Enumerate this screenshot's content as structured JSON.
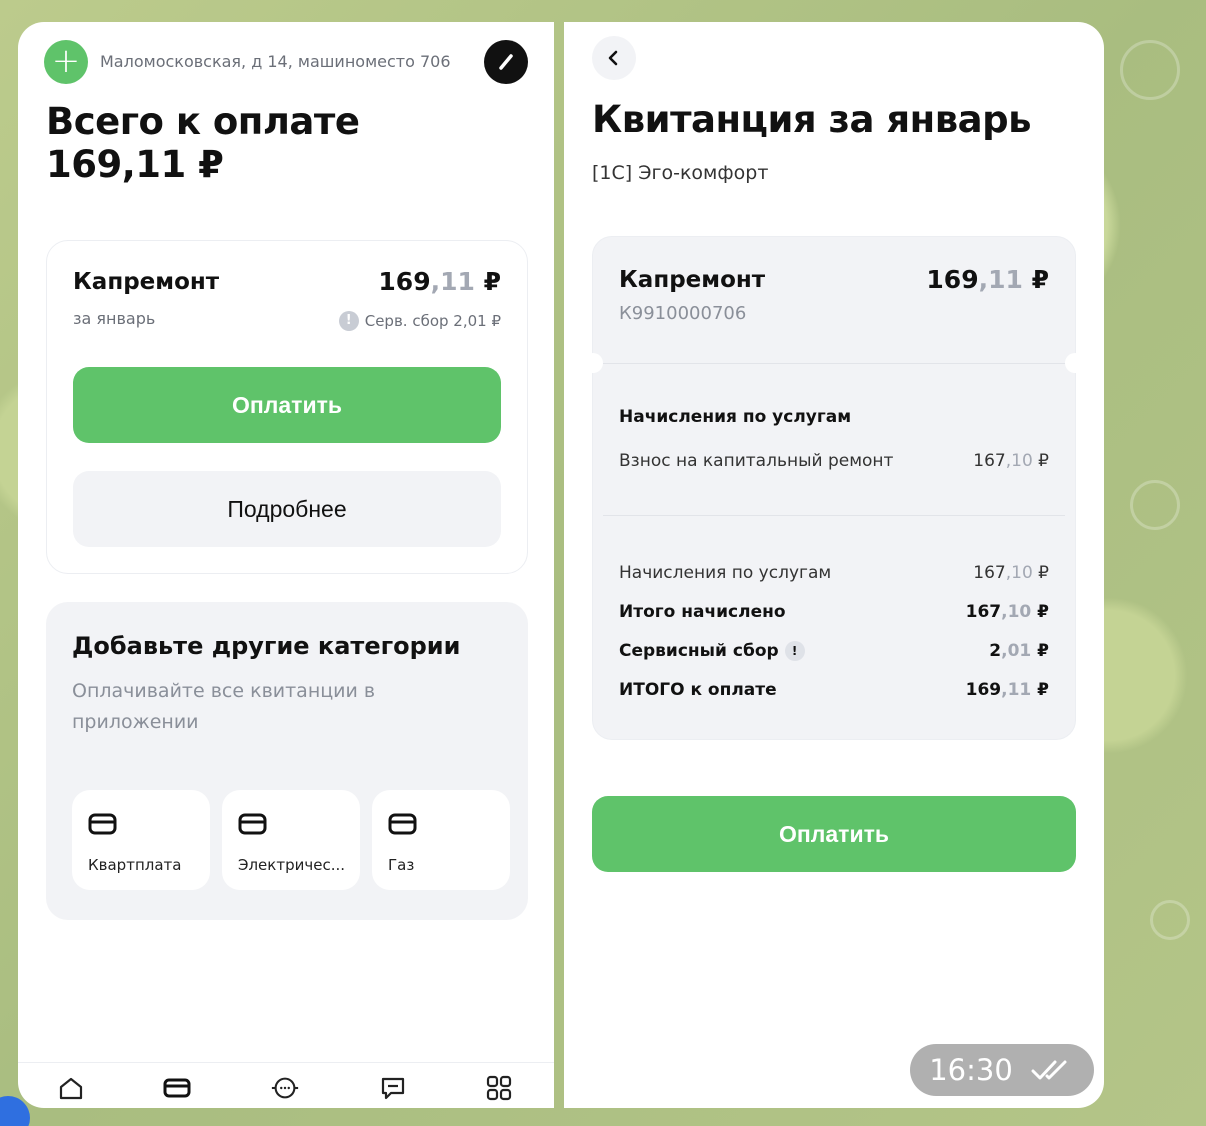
{
  "left": {
    "address": "Маломосковская, д 14, машиноместо 706",
    "total_title": "Всего к оплате",
    "total_amount": "169,11 ₽",
    "bill": {
      "title": "Капремонт",
      "period": "за январь",
      "amount_main": "169",
      "amount_kop": ",11",
      "currency": " ₽",
      "fee_text": "Серв. сбор 2,01 ₽",
      "pay_label": "Оплатить",
      "more_label": "Подробнее"
    },
    "categories": {
      "title": "Добавьте другие категории",
      "subtitle": "Оплачивайте все квитанции в приложении",
      "items": [
        {
          "label": "Квартплата",
          "icon": "wallet-icon"
        },
        {
          "label": "Электричес...",
          "icon": "wallet-icon"
        },
        {
          "label": "Газ",
          "icon": "wallet-icon"
        }
      ]
    },
    "tabs": [
      "home-icon",
      "wallet-icon",
      "meter-icon",
      "chat-icon",
      "grid-icon"
    ]
  },
  "right": {
    "title": "Квитанция за январь",
    "subtitle": "[1С] Эго-комфорт",
    "bill_title": "Капремонт",
    "account": "К9910000706",
    "amount_main": "169",
    "amount_kop": ",11",
    "currency": " ₽",
    "section_title": "Начисления по услугам",
    "service_row": {
      "label": "Взнос на капитальный ремонт",
      "main": "167",
      "kop": ",10",
      "cur": " ₽"
    },
    "summary": [
      {
        "label": "Начисления по услугам",
        "main": "167",
        "kop": ",10",
        "cur": " ₽",
        "bold": false
      },
      {
        "label": "Итого начислено",
        "main": "167",
        "kop": ",10",
        "cur": " ₽",
        "bold": true
      },
      {
        "label": "Сервисный сбор",
        "main": "2",
        "kop": ",01",
        "cur": " ₽",
        "bold": true
      },
      {
        "label": "ИТОГО к оплате",
        "main": "169",
        "kop": ",11",
        "cur": " ₽",
        "bold": true
      }
    ],
    "pay_label": "Оплатить"
  },
  "message": {
    "time": "16:30",
    "status_icon": "double-check-icon"
  },
  "colors": {
    "accent_green": "#5fc36a",
    "muted": "#a3a8b3",
    "background": "#b9c98a"
  }
}
